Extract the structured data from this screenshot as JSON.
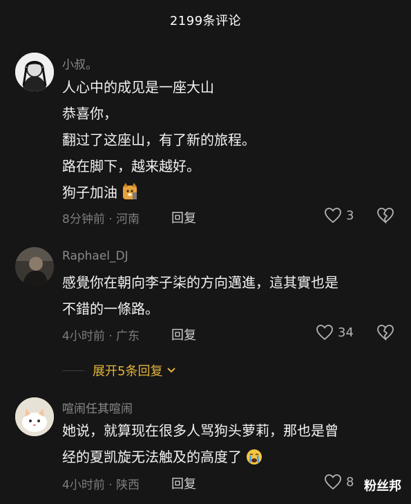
{
  "header": {
    "title": "2199条评论"
  },
  "comments": [
    {
      "username": "小叔。",
      "lines": [
        "人心中的成见是一座大山",
        "恭喜你，",
        "翻过了这座山，有了新的旅程。",
        "路在脚下，越来越好。",
        "狗子加油"
      ],
      "emoji": "dog-emoji",
      "time": "8分钟前",
      "location": "河南",
      "reply_label": "回复",
      "likes": "3"
    },
    {
      "username": "Raphael_DJ",
      "lines": [
        "感覺你在朝向李子柒的方向邁進，這其實也是",
        "不錯的一條路。"
      ],
      "time": "4小时前",
      "location": "广东",
      "reply_label": "回复",
      "likes": "34"
    },
    {
      "username": "喧闹任其喧闹",
      "lines": [
        "她说，就算现在很多人骂狗头萝莉，那也是曾",
        "经的夏凯旋无法触及的高度了"
      ],
      "emoji": "crying-face-emoji",
      "time": "4小时前",
      "location": "陕西",
      "reply_label": "回复",
      "likes": "8"
    }
  ],
  "expand_replies": {
    "label": "展开5条回复"
  },
  "watermark": "粉丝邦",
  "colors": {
    "background": "#161616",
    "accent": "#e4b43b",
    "muted": "#8a8a8a"
  }
}
